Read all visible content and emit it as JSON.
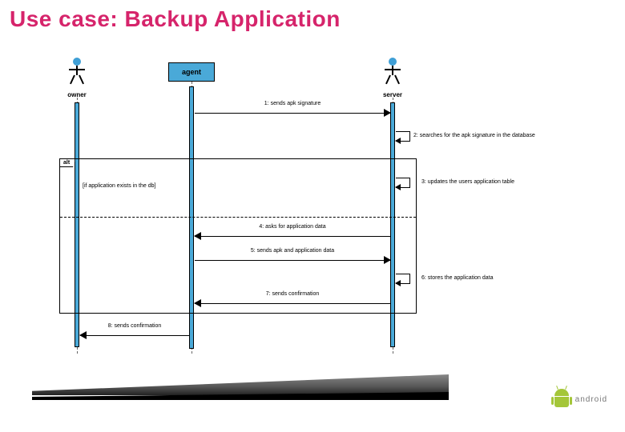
{
  "title": "Use case: Backup Application",
  "title_color": "#d6246b",
  "participants": {
    "owner": "owner",
    "agent": "agent",
    "server": "server"
  },
  "alt": {
    "tag": "alt",
    "guard": "[if application exists in the db]"
  },
  "messages": {
    "m1": "1: sends apk signature",
    "m2": "2: searches for the apk signature in the database",
    "m3": "3: updates the users application table",
    "m4": "4: asks for application data",
    "m5": "5: sends apk and application data",
    "m6": "6: stores the application data",
    "m7": "7: sends confirmation",
    "m8": "8: sends confirmation"
  },
  "footer_brand": "android",
  "chart_data": {
    "type": "sequence-diagram",
    "participants": [
      "owner",
      "agent",
      "server"
    ],
    "messages": [
      {
        "n": 1,
        "from": "agent",
        "to": "server",
        "text": "sends apk signature"
      },
      {
        "n": 2,
        "from": "server",
        "to": "server",
        "text": "searches for the apk signature in the database"
      },
      {
        "n": 3,
        "from": "server",
        "to": "server",
        "text": "updates the users application table",
        "fragment": "alt",
        "guard": "if application exists in the db"
      },
      {
        "n": 4,
        "from": "server",
        "to": "agent",
        "text": "asks for application data",
        "fragment": "alt-else"
      },
      {
        "n": 5,
        "from": "agent",
        "to": "server",
        "text": "sends apk and application data",
        "fragment": "alt-else"
      },
      {
        "n": 6,
        "from": "server",
        "to": "server",
        "text": "stores the application data",
        "fragment": "alt-else"
      },
      {
        "n": 7,
        "from": "server",
        "to": "agent",
        "text": "sends confirmation",
        "fragment": "alt-else"
      },
      {
        "n": 8,
        "from": "agent",
        "to": "owner",
        "text": "sends confirmation"
      }
    ],
    "fragments": [
      {
        "type": "alt",
        "guard": "if application exists in the db",
        "covers_messages": [
          3,
          4,
          5,
          6,
          7
        ]
      }
    ]
  }
}
